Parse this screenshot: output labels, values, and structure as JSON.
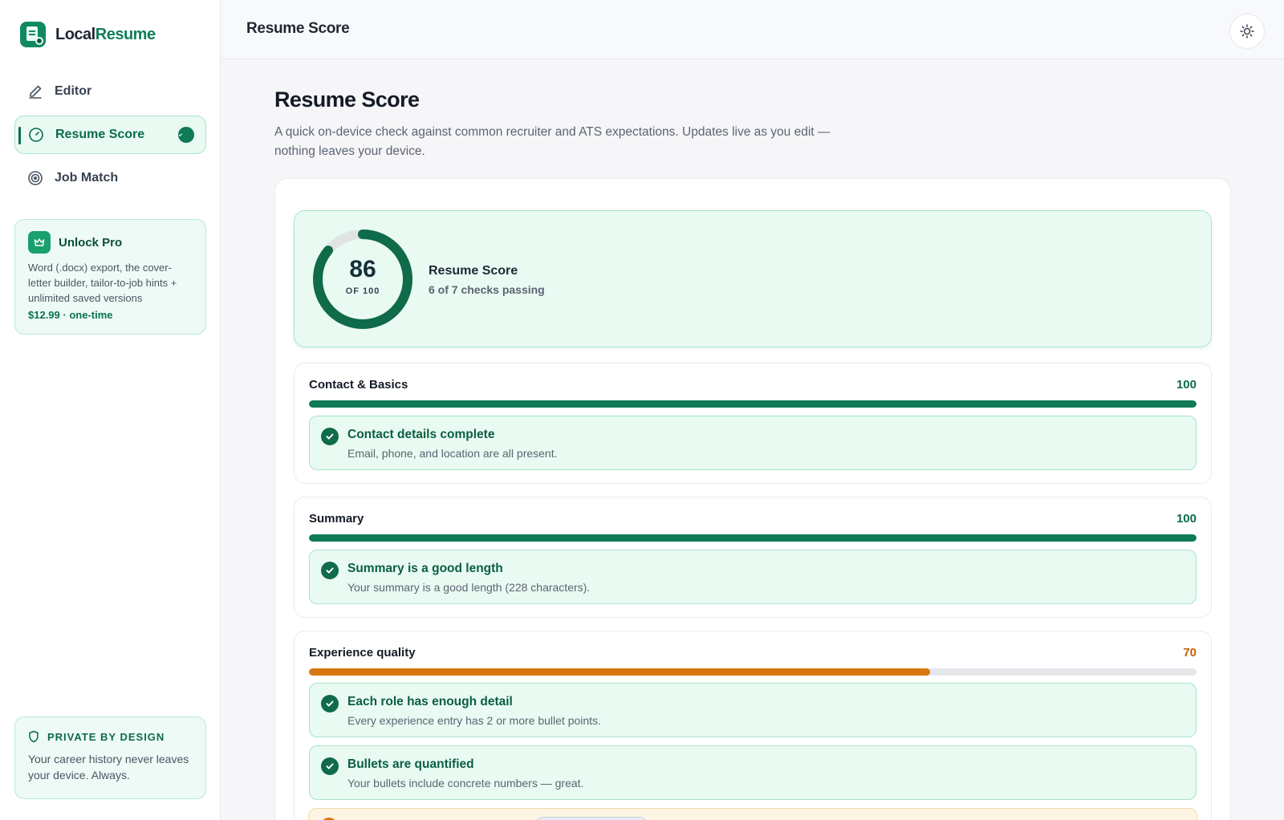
{
  "app": {
    "brand_first": "Local",
    "brand_second": "Resume",
    "accent_color": "#0f7a55",
    "warn_color": "#d9770f"
  },
  "sidebar": {
    "items": [
      {
        "label": "Editor",
        "icon": "pencil-icon"
      },
      {
        "label": "Resume Score",
        "icon": "gauge-icon",
        "active": true
      },
      {
        "label": "Job Match",
        "icon": "target-icon"
      }
    ],
    "pro": {
      "title": "Unlock Pro",
      "description": "Word (.docx) export, the cover-letter builder, tailor-to-job hints + unlimited saved versions",
      "price": "$12.99 · one-time",
      "icon": "crown-icon"
    },
    "privacy": {
      "title": "PRIVATE BY DESIGN",
      "description": "Your career history never leaves your device. Always.",
      "icon": "shield-icon"
    }
  },
  "topbar": {
    "title": "Resume Score",
    "theme_icon": "sun-icon"
  },
  "page": {
    "title": "Resume Score",
    "description": "A quick on-device check against common recruiter and ATS expectations. Updates live as you edit — nothing leaves your device."
  },
  "score": {
    "value": "86",
    "of_label": "OF 100",
    "fraction": 0.86,
    "title": "Resume Score",
    "subtitle": "6 of 7 checks passing"
  },
  "sections": [
    {
      "title": "Contact & Basics",
      "score": "100",
      "fill": 1.0,
      "checks": [
        {
          "title": "Contact details complete",
          "description": "Email, phone, and location are all present.",
          "status": "pass"
        }
      ]
    },
    {
      "title": "Summary",
      "score": "100",
      "fill": 1.0,
      "checks": [
        {
          "title": "Summary is a good length",
          "description": "Your summary is a good length (228 characters).",
          "status": "pass"
        }
      ]
    },
    {
      "title": "Experience quality",
      "score": "70",
      "fill": 0.7,
      "checks": [
        {
          "title": "Each role has enough detail",
          "description": "Every experience entry has 2 or more bullet points.",
          "status": "pass"
        },
        {
          "title": "Bullets are quantified",
          "description": "Your bullets include concrete numbers — great.",
          "status": "pass"
        }
      ]
    }
  ]
}
